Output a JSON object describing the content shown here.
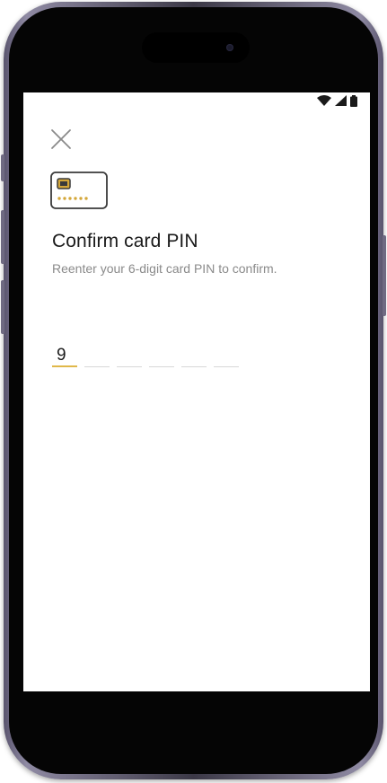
{
  "status_bar": {
    "icons": [
      "wifi-icon",
      "cellular-signal-icon",
      "battery-icon"
    ]
  },
  "header": {
    "close_icon": "close-icon"
  },
  "illustration": {
    "icon": "card-pin-icon",
    "accent_color": "#d4a73a"
  },
  "content": {
    "title": "Confirm card PIN",
    "subtitle": "Reenter your 6-digit card PIN to confirm."
  },
  "pin_input": {
    "length": 6,
    "digits": [
      "9",
      "",
      "",
      "",
      "",
      ""
    ],
    "active_color": "#e0b84a",
    "inactive_color": "#d8d8d8"
  }
}
